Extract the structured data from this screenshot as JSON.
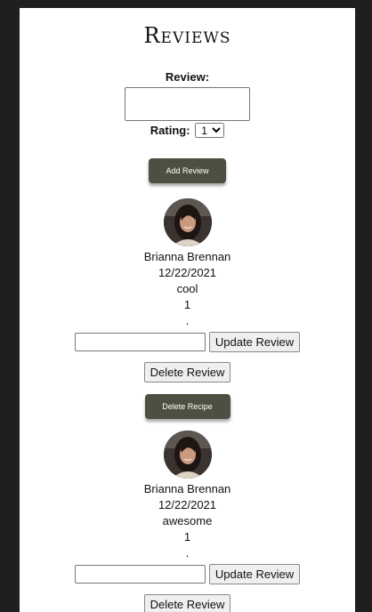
{
  "page": {
    "title": "Reviews"
  },
  "form": {
    "review_label": "Review:",
    "review_value": "",
    "rating_label": "Rating:",
    "rating_options": [
      "1"
    ],
    "rating_selected": "1",
    "add_button": "Add Review"
  },
  "reviews": [
    {
      "author": "Brianna Brennan",
      "date": "12/22/2021",
      "text": "cool",
      "rating": "1",
      "dot": ".",
      "update_value": "",
      "update_button": "Update Review",
      "delete_button": "Delete Review"
    },
    {
      "author": "Brianna Brennan",
      "date": "12/22/2021",
      "text": "awesome",
      "rating": "1",
      "dot": ".",
      "update_value": "",
      "update_button": "Update Review",
      "delete_button": "Delete Review"
    }
  ],
  "recipe": {
    "delete_button": "Delete Recipe"
  },
  "colors": {
    "background": "#1f1f1f",
    "panel": "#ffffff",
    "dark_button": "#4c5040"
  }
}
